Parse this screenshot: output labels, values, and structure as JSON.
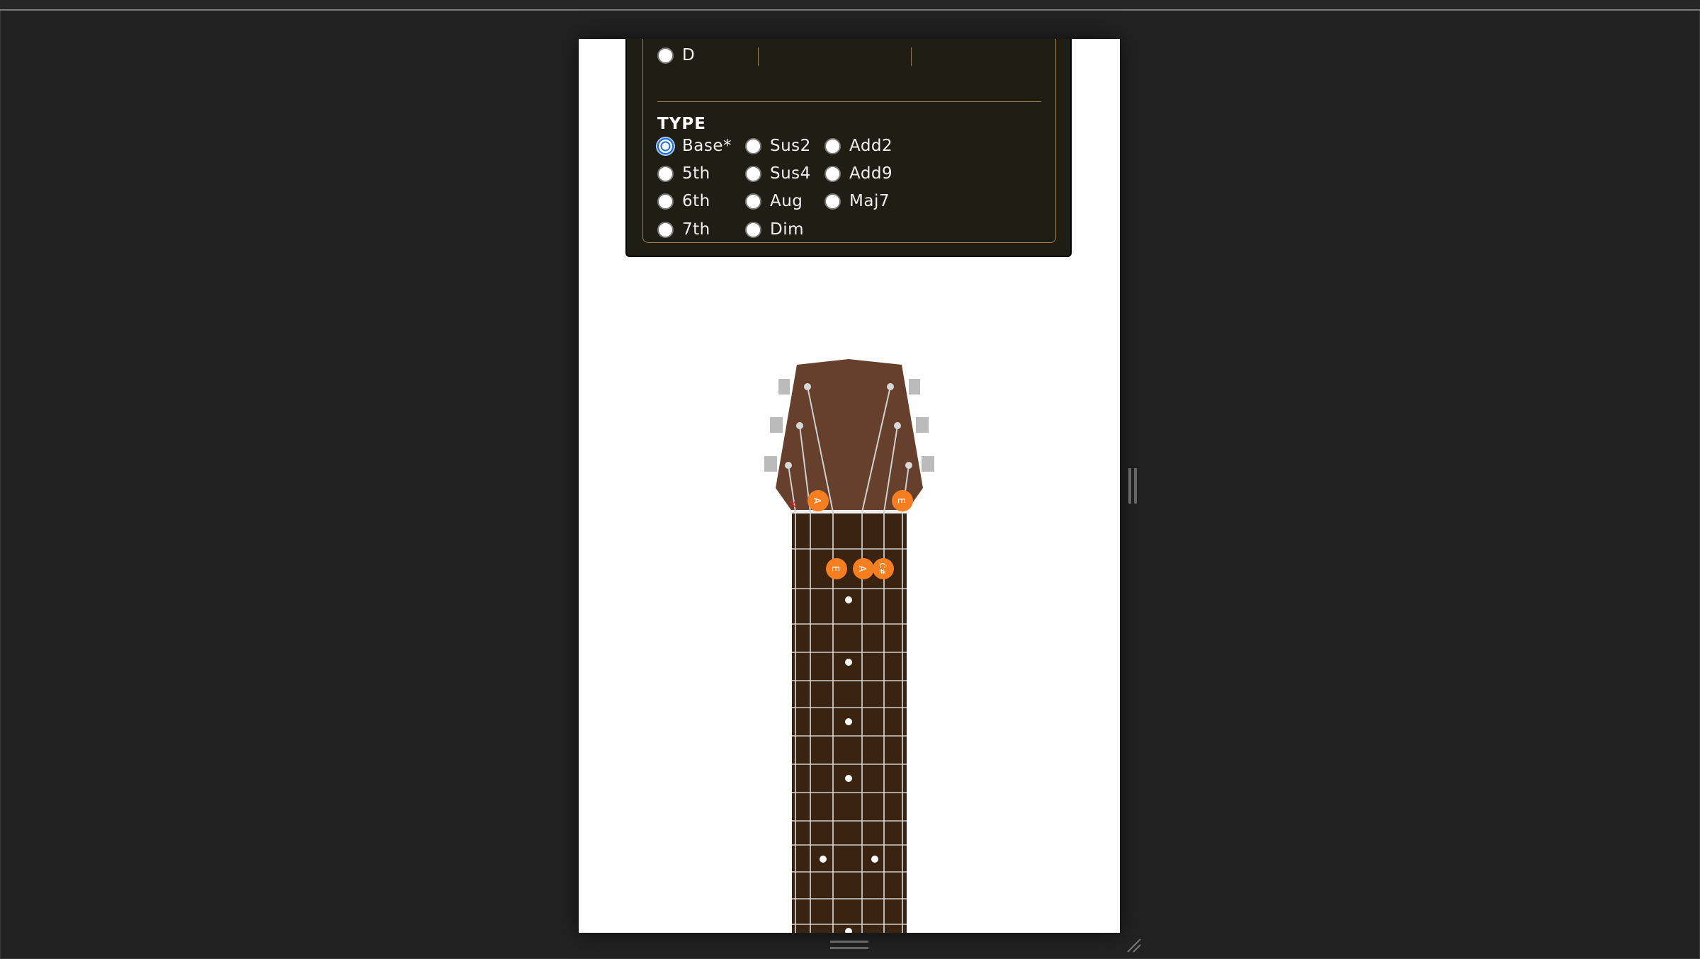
{
  "chord_panel": {
    "root_partial_label": "D",
    "type_heading": "TYPE",
    "types": [
      {
        "label": "Base*",
        "checked": true
      },
      {
        "label": "5th",
        "checked": false
      },
      {
        "label": "6th",
        "checked": false
      },
      {
        "label": "7th",
        "checked": false
      },
      {
        "label": "Sus2",
        "checked": false
      },
      {
        "label": "Sus4",
        "checked": false
      },
      {
        "label": "Aug",
        "checked": false
      },
      {
        "label": "Dim",
        "checked": false
      },
      {
        "label": "Add2",
        "checked": false
      },
      {
        "label": "Add9",
        "checked": false
      },
      {
        "label": "Maj7",
        "checked": false
      }
    ]
  },
  "fretboard": {
    "muted_string_marker": "×",
    "open_notes": [
      "A",
      "E"
    ],
    "fretted_notes": [
      "E",
      "A",
      "C#"
    ]
  },
  "colors": {
    "note_marker": "#f57f20",
    "fretboard": "#3b2312",
    "headstock": "#663f2d",
    "panel_bg": "#1f1e14",
    "accent_border": "#a07a4a"
  }
}
